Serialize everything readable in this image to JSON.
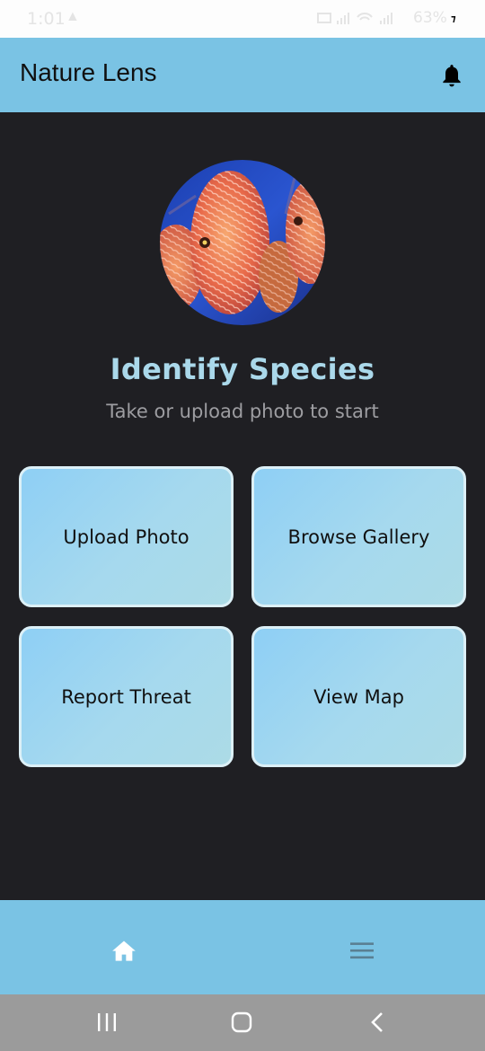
{
  "status_bar": {
    "time": "1:01",
    "alert_icon": "warning-triangle-icon",
    "battery_text": "63%",
    "icons": [
      "vibrate-icon",
      "wifi-icon",
      "signal-icon",
      "battery-icon"
    ]
  },
  "app_bar": {
    "title": "Nature Lens",
    "action_icon": "bell-icon",
    "background": "#7ac3e4"
  },
  "hero": {
    "image": "discus-fish-photo"
  },
  "main": {
    "heading": "Identify Species",
    "subheading": "Take or upload photo to start",
    "accent_color": "#aad8ea"
  },
  "tiles": [
    {
      "label": "Upload Photo"
    },
    {
      "label": "Browse Gallery"
    },
    {
      "label": "Report Threat"
    },
    {
      "label": "View Map"
    }
  ],
  "bottom_nav": {
    "items": [
      {
        "icon": "home-icon",
        "active": true
      },
      {
        "icon": "menu-icon",
        "active": false
      }
    ]
  },
  "system_nav": {
    "items": [
      "recents-icon",
      "home-circle-icon",
      "back-icon"
    ]
  }
}
